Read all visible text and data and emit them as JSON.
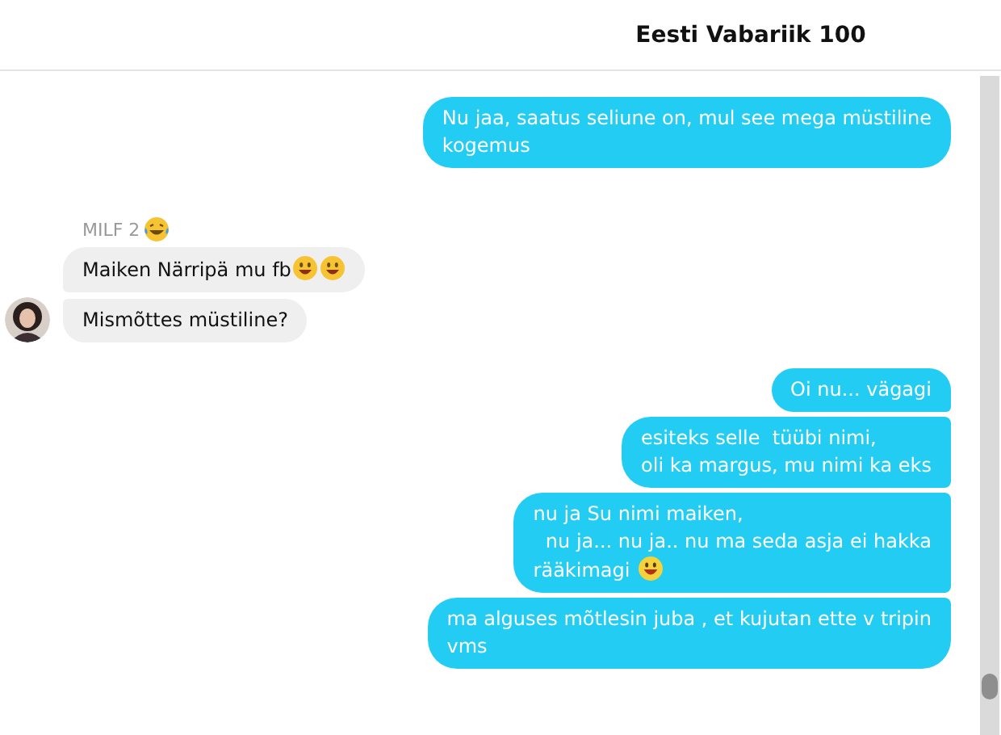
{
  "header": {
    "title": "Eesti Vabariik 100"
  },
  "groups": [
    {
      "kind": "outgoing",
      "messages": [
        {
          "text": "Nu jaa, saatus seliune on, mul see mega müstiline\nkogemus"
        }
      ]
    },
    {
      "kind": "incoming",
      "sender": {
        "name": "MILF 2",
        "emojis": [
          {
            "kind": "laughing"
          }
        ]
      },
      "messages": [
        {
          "text": "Maiken Närripä mu fb",
          "emojis": [
            {
              "kind": "grin"
            },
            {
              "kind": "grin"
            }
          ]
        },
        {
          "text": "Mismõttes müstiline?"
        }
      ]
    },
    {
      "kind": "outgoing",
      "messages": [
        {
          "text": "Oi nu... vägagi"
        },
        {
          "text": "esiteks selle  tüübi nimi,\noli ka margus, mu nimi ka eks"
        },
        {
          "text": "nu ja Su nimi maiken,\n  nu ja... nu ja.. nu ma seda asja ei hakka\nrääkimagi ",
          "emojis": [
            {
              "kind": "smile"
            }
          ]
        },
        {
          "text": "ma alguses mõtlesin juba , et kujutan ette v tripin\nvms"
        }
      ]
    }
  ]
}
